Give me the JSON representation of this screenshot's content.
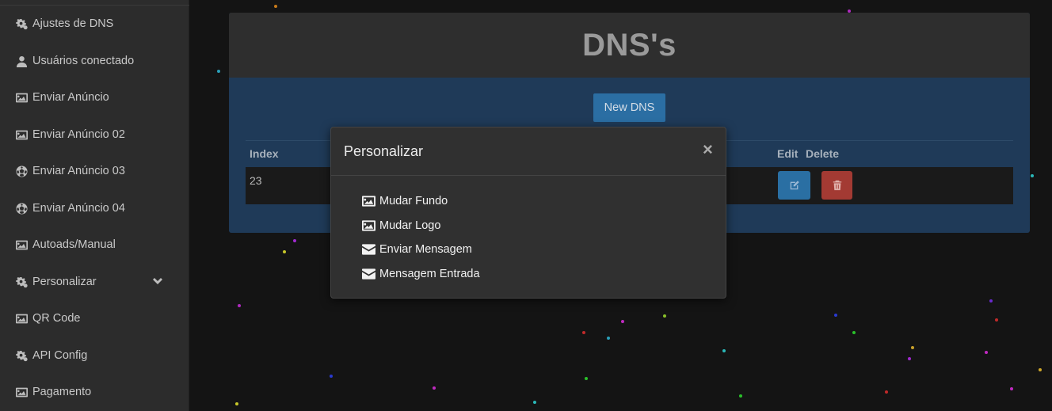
{
  "sidebar": {
    "items": [
      {
        "label": "Ajustes de DNS",
        "icon": "gears-icon"
      },
      {
        "label": "Usuários conectado",
        "icon": "user-icon"
      },
      {
        "label": "Enviar Anúncio",
        "icon": "image-icon"
      },
      {
        "label": "Enviar Anúncio 02",
        "icon": "image-icon"
      },
      {
        "label": "Enviar Anúncio 03",
        "icon": "soccer-ball-icon"
      },
      {
        "label": "Enviar Anúncio 04",
        "icon": "soccer-ball-icon"
      },
      {
        "label": "Autoads/Manual",
        "icon": "image-icon"
      },
      {
        "label": "Personalizar",
        "icon": "gears-icon"
      },
      {
        "label": "QR Code",
        "icon": "image-icon"
      },
      {
        "label": "API Config",
        "icon": "gears-icon"
      },
      {
        "label": "Pagamento",
        "icon": "image-icon"
      }
    ]
  },
  "panel": {
    "title": "DNS's",
    "new_button": "New DNS",
    "columns": [
      "Index",
      "Edit",
      "Delete"
    ],
    "rows": [
      {
        "index": "23"
      }
    ]
  },
  "modal": {
    "title": "Personalizar",
    "close": "×",
    "items": [
      {
        "label": "Mudar Fundo",
        "icon": "image-icon"
      },
      {
        "label": "Mudar Logo",
        "icon": "image-icon"
      },
      {
        "label": "Enviar Mensagem",
        "icon": "envelope-icon"
      },
      {
        "label": "Mensagem Entrada",
        "icon": "envelope-icon"
      }
    ]
  },
  "colors": {
    "sidebar_bg": "#2c2c2c",
    "panel_bg": "#1f3a58",
    "primary_button": "#2b6ea3",
    "danger_button": "#a33a33",
    "modal_bg": "#303030"
  }
}
